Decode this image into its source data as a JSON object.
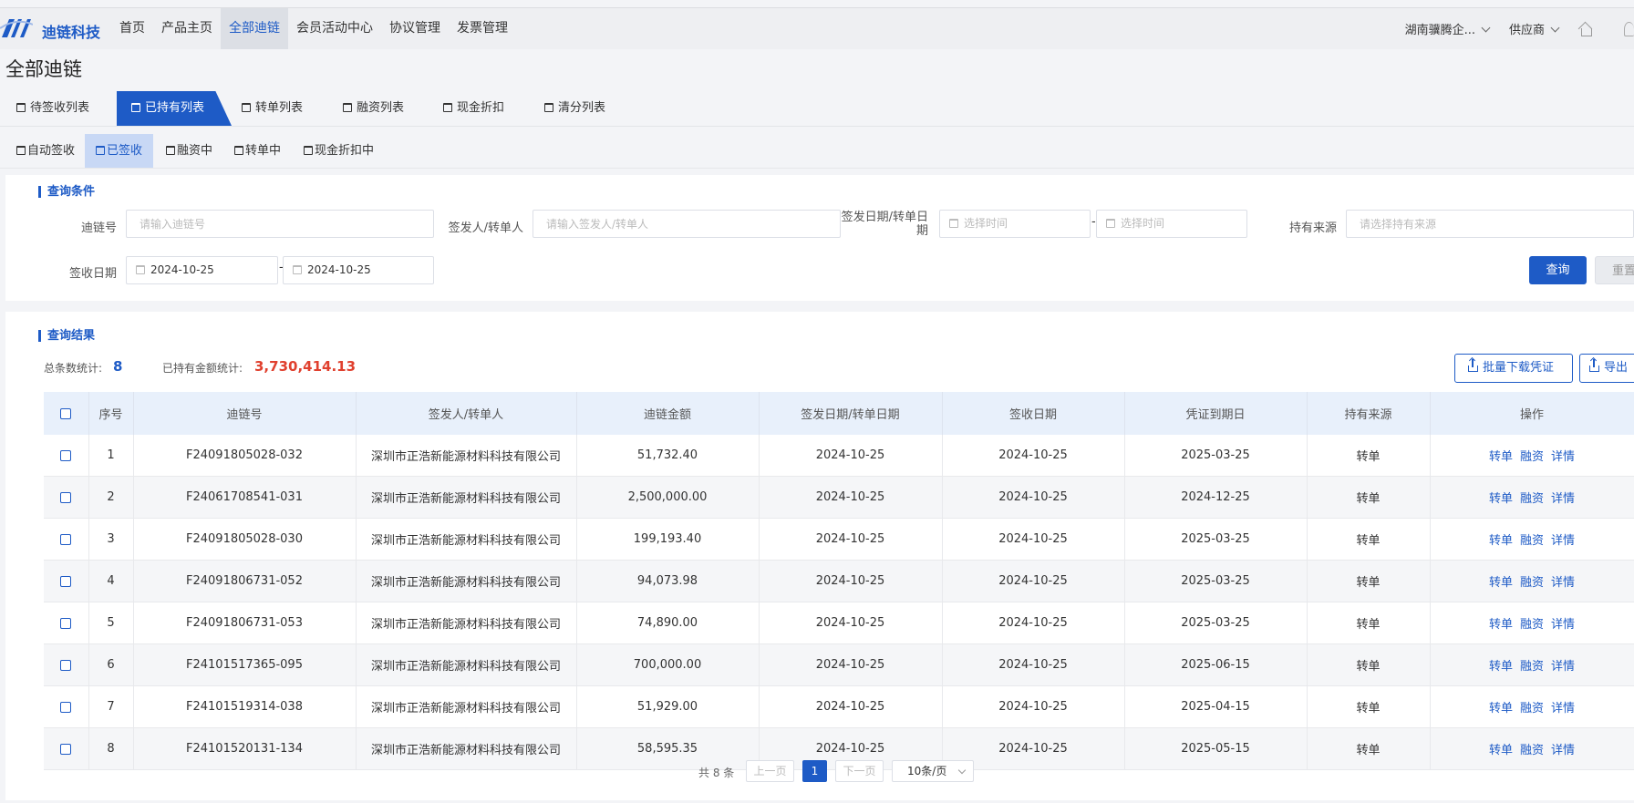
{
  "header": {
    "brand": "迪链科技",
    "nav": [
      "首页",
      "产品主页",
      "全部迪链",
      "会员活动中心",
      "协议管理",
      "发票管理"
    ],
    "active_nav": 2,
    "company": "湖南骥腾企...",
    "role": "供应商"
  },
  "page_title": "全部迪链",
  "tabs": [
    "待签收列表",
    "已持有列表",
    "转单列表",
    "融资列表",
    "现金折扣",
    "清分列表"
  ],
  "active_tab": 1,
  "subtabs": [
    "自动签收",
    "已签收",
    "融资中",
    "转单中",
    "现金折扣中"
  ],
  "active_subtab": 1,
  "query": {
    "title": "查询条件",
    "chain_no_label": "迪链号",
    "chain_no_placeholder": "请输入迪链号",
    "issuer_label": "签发人/转单人",
    "issuer_placeholder": "请输入签发人/转单人",
    "issue_date_label_1": "签发日期/转单日",
    "issue_date_label_2": "期",
    "date_placeholder": "选择时间",
    "source_label": "持有来源",
    "source_placeholder": "请选择持有来源",
    "sign_date_label": "签收日期",
    "sign_date_from": "2024-10-25",
    "sign_date_to": "2024-10-25",
    "dash": "-",
    "search_btn": "查询",
    "reset_btn": "重置"
  },
  "result": {
    "title": "查询结果",
    "total_label": "总条数统计:",
    "total": "8",
    "amount_label": "已持有金额统计:",
    "amount": "3,730,414.13",
    "batch_download": "批量下载凭证",
    "export": "导出"
  },
  "table": {
    "headers": [
      "序号",
      "迪链号",
      "签发人/转单人",
      "迪链金额",
      "签发日期/转单日期",
      "签收日期",
      "凭证到期日",
      "持有来源",
      "操作"
    ],
    "actions": [
      "转单",
      "融资",
      "详情"
    ],
    "rows": [
      {
        "no": "1",
        "chain": "F24091805028-032",
        "issuer": "深圳市正浩新能源材料科技有限公司",
        "amount": "51,732.40",
        "issue_date": "2024-10-25",
        "sign_date": "2024-10-25",
        "due": "2025-03-25",
        "source": "转单"
      },
      {
        "no": "2",
        "chain": "F24061708541-031",
        "issuer": "深圳市正浩新能源材料科技有限公司",
        "amount": "2,500,000.00",
        "issue_date": "2024-10-25",
        "sign_date": "2024-10-25",
        "due": "2024-12-25",
        "source": "转单"
      },
      {
        "no": "3",
        "chain": "F24091805028-030",
        "issuer": "深圳市正浩新能源材料科技有限公司",
        "amount": "199,193.40",
        "issue_date": "2024-10-25",
        "sign_date": "2024-10-25",
        "due": "2025-03-25",
        "source": "转单"
      },
      {
        "no": "4",
        "chain": "F24091806731-052",
        "issuer": "深圳市正浩新能源材料科技有限公司",
        "amount": "94,073.98",
        "issue_date": "2024-10-25",
        "sign_date": "2024-10-25",
        "due": "2025-03-25",
        "source": "转单"
      },
      {
        "no": "5",
        "chain": "F24091806731-053",
        "issuer": "深圳市正浩新能源材料科技有限公司",
        "amount": "74,890.00",
        "issue_date": "2024-10-25",
        "sign_date": "2024-10-25",
        "due": "2025-03-25",
        "source": "转单"
      },
      {
        "no": "6",
        "chain": "F24101517365-095",
        "issuer": "深圳市正浩新能源材料科技有限公司",
        "amount": "700,000.00",
        "issue_date": "2024-10-25",
        "sign_date": "2024-10-25",
        "due": "2025-06-15",
        "source": "转单"
      },
      {
        "no": "7",
        "chain": "F24101519314-038",
        "issuer": "深圳市正浩新能源材料科技有限公司",
        "amount": "51,929.00",
        "issue_date": "2024-10-25",
        "sign_date": "2024-10-25",
        "due": "2025-04-15",
        "source": "转单"
      },
      {
        "no": "8",
        "chain": "F24101520131-134",
        "issuer": "深圳市正浩新能源材料科技有限公司",
        "amount": "58,595.35",
        "issue_date": "2024-10-25",
        "sign_date": "2024-10-25",
        "due": "2025-05-15",
        "source": "转单"
      }
    ]
  },
  "pagination": {
    "total_text": "共 8 条",
    "prev": "上一页",
    "page": "1",
    "next": "下一页",
    "page_size": "10条/页"
  }
}
